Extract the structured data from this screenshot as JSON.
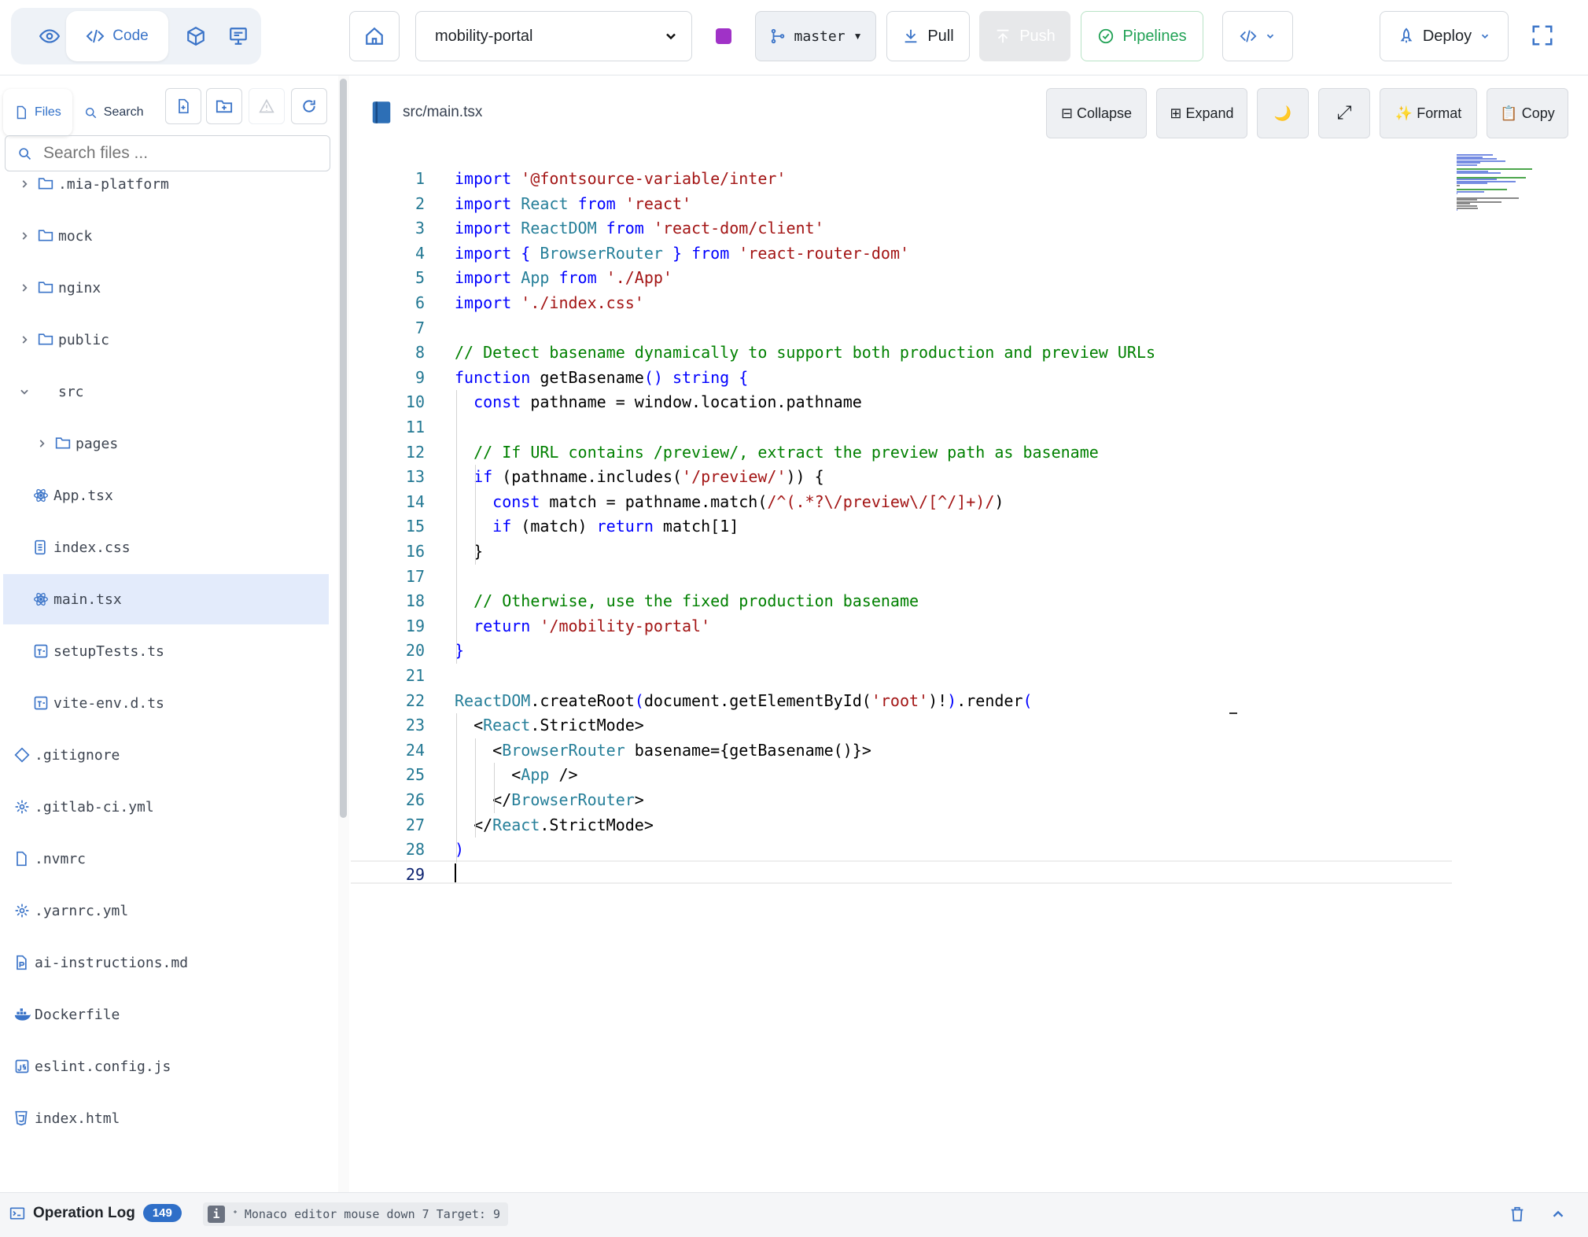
{
  "topbar": {
    "view_modes": [
      {
        "icon": "eye-icon",
        "label": ""
      },
      {
        "icon": "code-icon",
        "label": "Code"
      },
      {
        "icon": "cube-icon",
        "label": ""
      },
      {
        "icon": "monitor-icon",
        "label": ""
      }
    ],
    "project_select": "mobility-portal",
    "branch": "master",
    "pull_label": "Pull",
    "push_label": "Push",
    "pipelines_label": "Pipelines",
    "deploy_label": "Deploy",
    "colors": {
      "accent": "#2f6fc8",
      "pipelines": "#22a256",
      "branch_badge": "#a032c7"
    }
  },
  "sidebar": {
    "tabs": [
      {
        "label": "Files"
      },
      {
        "label": "Search"
      }
    ],
    "search_placeholder": "Search files ...",
    "tree": [
      {
        "name": ".mia-platform",
        "type": "folder",
        "expanded": false,
        "depth": 0
      },
      {
        "name": "mock",
        "type": "folder",
        "expanded": false,
        "depth": 0
      },
      {
        "name": "nginx",
        "type": "folder",
        "expanded": false,
        "depth": 0
      },
      {
        "name": "public",
        "type": "folder",
        "expanded": false,
        "depth": 0
      },
      {
        "name": "src",
        "type": "folder",
        "expanded": true,
        "depth": 0
      },
      {
        "name": "pages",
        "type": "folder",
        "expanded": false,
        "depth": 1
      },
      {
        "name": "App.tsx",
        "type": "react",
        "depth": 1
      },
      {
        "name": "index.css",
        "type": "css",
        "depth": 1
      },
      {
        "name": "main.tsx",
        "type": "react",
        "depth": 1,
        "selected": true
      },
      {
        "name": "setupTests.ts",
        "type": "ts",
        "depth": 1
      },
      {
        "name": "vite-env.d.ts",
        "type": "ts",
        "depth": 1
      },
      {
        "name": ".gitignore",
        "type": "git",
        "depth": 0
      },
      {
        "name": ".gitlab-ci.yml",
        "type": "gear",
        "depth": 0
      },
      {
        "name": ".nvmrc",
        "type": "file",
        "depth": 0
      },
      {
        "name": ".yarnrc.yml",
        "type": "gear",
        "depth": 0
      },
      {
        "name": "ai-instructions.md",
        "type": "md",
        "depth": 0
      },
      {
        "name": "Dockerfile",
        "type": "docker",
        "depth": 0
      },
      {
        "name": "eslint.config.js",
        "type": "js",
        "depth": 0
      },
      {
        "name": "index.html",
        "type": "html",
        "depth": 0
      }
    ]
  },
  "editor": {
    "file_path": "src/main.tsx",
    "buttons": [
      {
        "icon": "",
        "label": "⊟ Collapse"
      },
      {
        "icon": "",
        "label": "⊞ Expand"
      },
      {
        "icon": "moon-icon",
        "label": "🌙"
      },
      {
        "icon": "maximize-icon",
        "label": "⤢"
      },
      {
        "icon": "sparkles-icon",
        "label": "✨ Format"
      },
      {
        "icon": "clipboard-icon",
        "label": "📋 Copy"
      }
    ],
    "lines": [
      [
        [
          "kw",
          "import"
        ],
        [
          "",
          ""
        ],
        [
          "",
          " "
        ],
        [
          "str",
          "'@fontsource-variable/inter'"
        ]
      ],
      [
        [
          "kw",
          "import"
        ],
        [
          "",
          " "
        ],
        [
          "ty",
          "React"
        ],
        [
          "",
          " "
        ],
        [
          "kw",
          "from"
        ],
        [
          "",
          " "
        ],
        [
          "str",
          "'react'"
        ]
      ],
      [
        [
          "kw",
          "import"
        ],
        [
          "",
          " "
        ],
        [
          "ty",
          "ReactDOM"
        ],
        [
          "",
          " "
        ],
        [
          "kw",
          "from"
        ],
        [
          "",
          " "
        ],
        [
          "str",
          "'react-dom/client'"
        ]
      ],
      [
        [
          "kw",
          "import"
        ],
        [
          "",
          " "
        ],
        [
          "kw",
          "{"
        ],
        [
          "",
          " "
        ],
        [
          "ty",
          "BrowserRouter"
        ],
        [
          "",
          " "
        ],
        [
          "kw",
          "}"
        ],
        [
          "",
          " "
        ],
        [
          "kw",
          "from"
        ],
        [
          "",
          " "
        ],
        [
          "str",
          "'react-router-dom'"
        ]
      ],
      [
        [
          "kw",
          "import"
        ],
        [
          "",
          " "
        ],
        [
          "ty",
          "App"
        ],
        [
          "",
          " "
        ],
        [
          "kw",
          "from"
        ],
        [
          "",
          " "
        ],
        [
          "str",
          "'./App'"
        ]
      ],
      [
        [
          "kw",
          "import"
        ],
        [
          "",
          " "
        ],
        [
          "str",
          "'./index.css'"
        ]
      ],
      [],
      [
        [
          "cm",
          "// Detect basename dynamically to support both production and preview URLs"
        ]
      ],
      [
        [
          "kw",
          "function"
        ],
        [
          "",
          " getBasename"
        ],
        [
          "kw",
          "()"
        ],
        [
          ":",
          " "
        ],
        [
          "kw",
          "string"
        ],
        [
          "",
          " "
        ],
        [
          "kw",
          "{"
        ]
      ],
      [
        [
          "",
          "  "
        ],
        [
          "kw",
          "const"
        ],
        [
          "",
          " pathname = window.location.pathname"
        ]
      ],
      [],
      [
        [
          "",
          "  "
        ],
        [
          "cm",
          "// If URL contains /preview/, extract the preview path as basename"
        ]
      ],
      [
        [
          "",
          "  "
        ],
        [
          "kw",
          "if"
        ],
        [
          "",
          " "
        ],
        [
          "",
          "("
        ],
        [
          "",
          "pathname.includes"
        ],
        [
          "",
          "("
        ],
        [
          "str",
          "'/preview/'"
        ],
        [
          "",
          "))"
        ],
        [
          "",
          " "
        ],
        [
          "",
          "{"
        ]
      ],
      [
        [
          "",
          "    "
        ],
        [
          "kw",
          "const"
        ],
        [
          "",
          " match = pathname.match"
        ],
        [
          "",
          "("
        ],
        [
          "str",
          "/^(.*?\\/preview\\/[^/]+)/"
        ],
        [
          "",
          ")"
        ]
      ],
      [
        [
          "",
          "    "
        ],
        [
          "kw",
          "if"
        ],
        [
          "",
          " (match) "
        ],
        [
          "kw",
          "return"
        ],
        [
          "",
          " match[1]"
        ]
      ],
      [
        [
          "",
          "  "
        ],
        [
          "",
          "}"
        ]
      ],
      [],
      [
        [
          "",
          "  "
        ],
        [
          "cm",
          "// Otherwise, use the fixed production basename"
        ]
      ],
      [
        [
          "",
          "  "
        ],
        [
          "kw",
          "return"
        ],
        [
          "",
          " "
        ],
        [
          "str",
          "'/mobility-portal'"
        ]
      ],
      [
        [
          "kw",
          "}"
        ]
      ],
      [],
      [
        [
          "ty",
          "ReactDOM"
        ],
        [
          "",
          ".createRoot"
        ],
        [
          "kw",
          "("
        ],
        [
          "",
          "document.getElementById"
        ],
        [
          "",
          "("
        ],
        [
          "str",
          "'root'"
        ],
        [
          "",
          ")"
        ],
        [
          "",
          "!"
        ],
        [
          "kw",
          ")"
        ],
        [
          "",
          ".render"
        ],
        [
          "kw",
          "("
        ]
      ],
      [
        [
          "",
          "  <"
        ],
        [
          "ty",
          "React"
        ],
        [
          "",
          ".StrictMode>"
        ]
      ],
      [
        [
          "",
          "    <"
        ],
        [
          "ty",
          "BrowserRouter"
        ],
        [
          "",
          " basename="
        ],
        [
          "",
          "{"
        ],
        [
          "",
          "getBasename()"
        ],
        [
          "",
          "}"
        ],
        [
          "",
          ">"
        ]
      ],
      [
        [
          "",
          "      <"
        ],
        [
          "ty",
          "App"
        ],
        [
          "",
          " />"
        ]
      ],
      [
        [
          "",
          "    </"
        ],
        [
          "ty",
          "BrowserRouter"
        ],
        [
          "",
          ">"
        ]
      ],
      [
        [
          "",
          "  </"
        ],
        [
          "ty",
          "React"
        ],
        [
          "",
          ".StrictMode>"
        ]
      ],
      [
        [
          "kw",
          ")"
        ]
      ],
      []
    ],
    "cursor_line": 29
  },
  "statusbar": {
    "title": "Operation Log",
    "count": "149",
    "message": "ᐩ Monaco editor mouse down 7 Target: 9"
  }
}
